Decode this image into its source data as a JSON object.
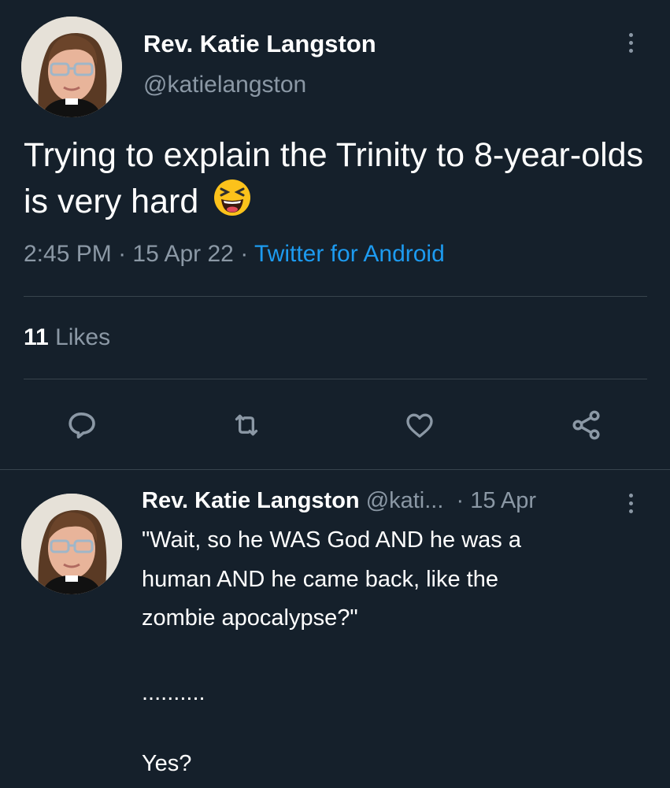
{
  "main_tweet": {
    "author_name": "Rev. Katie Langston",
    "handle": "@katielangston",
    "text": "Trying to explain the Trinity to 8-year-olds is very hard",
    "emoji": "laughing-squint-emoji",
    "time": "2:45 PM",
    "date": "15 Apr 22",
    "separator": "·",
    "source": "Twitter for Android",
    "likes_count": "11",
    "likes_label": "Likes"
  },
  "actions": [
    {
      "name": "reply",
      "icon": "reply-icon"
    },
    {
      "name": "retweet",
      "icon": "retweet-icon"
    },
    {
      "name": "like",
      "icon": "heart-icon"
    },
    {
      "name": "share",
      "icon": "share-icon"
    }
  ],
  "reply_tweet": {
    "author_name": "Rev. Katie Langston",
    "handle": "@kati...",
    "date": "· 15 Apr",
    "lines": [
      "\"Wait, so he WAS God AND he was a",
      "human AND he came back, like the",
      "zombie apocalypse?\"",
      "..........",
      "Yes?"
    ]
  },
  "colors": {
    "background": "#15202b",
    "text": "#ffffff",
    "secondary_text": "#8b98a5",
    "link": "#1d9bf0",
    "divider": "#38444d"
  }
}
